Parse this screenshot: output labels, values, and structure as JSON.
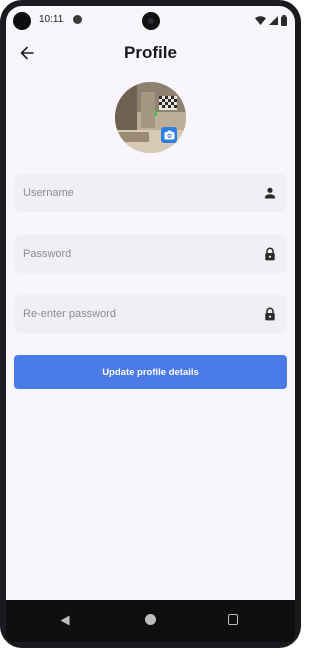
{
  "status_bar": {
    "time": "10:11"
  },
  "app_bar": {
    "title": "Profile"
  },
  "form": {
    "username": {
      "value": "",
      "placeholder": "Username"
    },
    "password": {
      "value": "",
      "placeholder": "Password"
    },
    "repassword": {
      "value": "",
      "placeholder": "Re-enter password"
    },
    "submit_label": "Update profile details"
  },
  "icons": {
    "back": "arrow-left-icon",
    "username": "person-icon",
    "password": "lock-icon",
    "repassword": "lock-icon",
    "edit_photo": "camera-icon"
  },
  "colors": {
    "primary": "#4a7ae6",
    "background": "#f8f6fc",
    "field_bg": "#f1eff4"
  }
}
